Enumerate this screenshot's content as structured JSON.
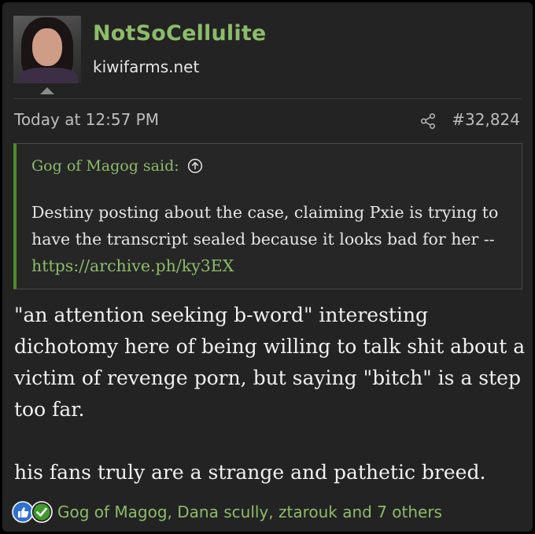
{
  "user": {
    "name": "NotSoCellulite",
    "title": "kiwifarms.net",
    "avatar_icon": "user-avatar"
  },
  "post": {
    "timestamp": "Today at 12:57 PM",
    "number": "#32,824"
  },
  "quote": {
    "author_said": "Gog of Magog said:",
    "text": "Destiny posting about the case, claiming Pxie is trying to have the transcript sealed because it looks bad for her -- ",
    "link": "https://archive.ph/ky3EX"
  },
  "message": {
    "paragraph1": "\"an attention seeking b-word\" interesting dichotomy here of being willing to talk shit about a victim of revenge porn, but saying \"bitch\" is a step too far.",
    "paragraph2": "his fans truly are a strange and pathetic breed."
  },
  "reactions": {
    "names": "Gog of Magog, Dana scully, ztarouk and 7 others"
  },
  "colors": {
    "background": "#232323",
    "accent_green": "#8dbb6a",
    "quote_bar": "#4e8a2e",
    "like_blue": "#2e6fd0",
    "check_green": "#3f9a2c"
  }
}
